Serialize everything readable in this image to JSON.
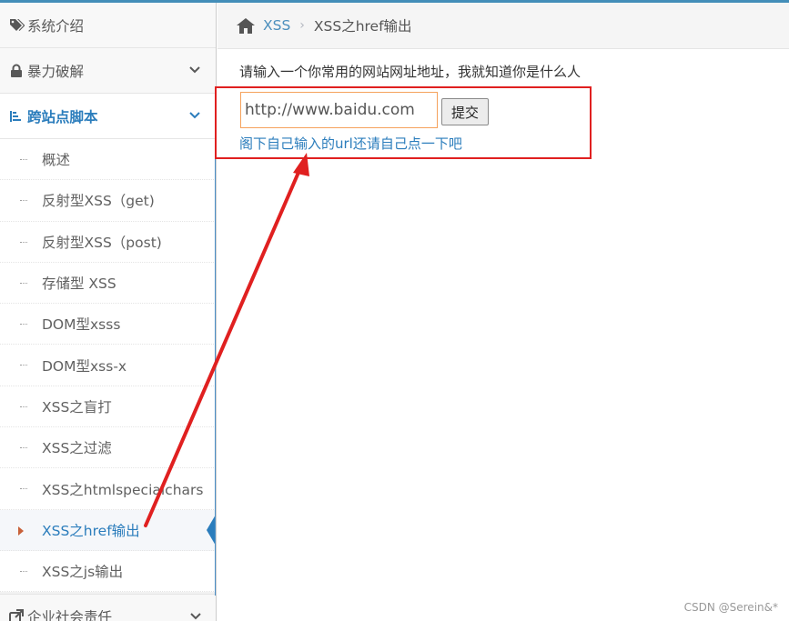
{
  "sidebar": {
    "top_items": [
      {
        "label": "系统介绍",
        "icon": "tags-icon"
      },
      {
        "label": "暴力破解",
        "icon": "lock-icon"
      },
      {
        "label": "跨站点脚本",
        "icon": "sitemap-icon"
      }
    ],
    "sub_items": [
      {
        "label": "概述"
      },
      {
        "label": "反射型XSS（get)"
      },
      {
        "label": "反射型XSS（post)"
      },
      {
        "label": "存储型 XSS"
      },
      {
        "label": "DOM型xsss"
      },
      {
        "label": "DOM型xss-x"
      },
      {
        "label": "XSS之盲打"
      },
      {
        "label": "XSS之过滤"
      },
      {
        "label": "XSS之htmlspecialchars"
      },
      {
        "label": "XSS之href输出"
      },
      {
        "label": "XSS之js输出"
      }
    ],
    "bottom_item": {
      "label": "企业社会责任",
      "icon": "external-link-icon"
    }
  },
  "breadcrumb": {
    "home_icon": "home-icon",
    "parent": "XSS",
    "current": "XSS之href输出"
  },
  "main": {
    "prompt": "请输入一个你常用的网站网址地址，我就知道你是什么人",
    "input_value": "http://www.baidu.com",
    "submit_label": "提交",
    "result_link": "阁下自己输入的url还请自己点一下吧"
  },
  "watermark": "CSDN @Serein&*",
  "colors": {
    "accent": "#2b7dbc",
    "annotation": "#e02020",
    "input_border": "#f5a25c"
  }
}
